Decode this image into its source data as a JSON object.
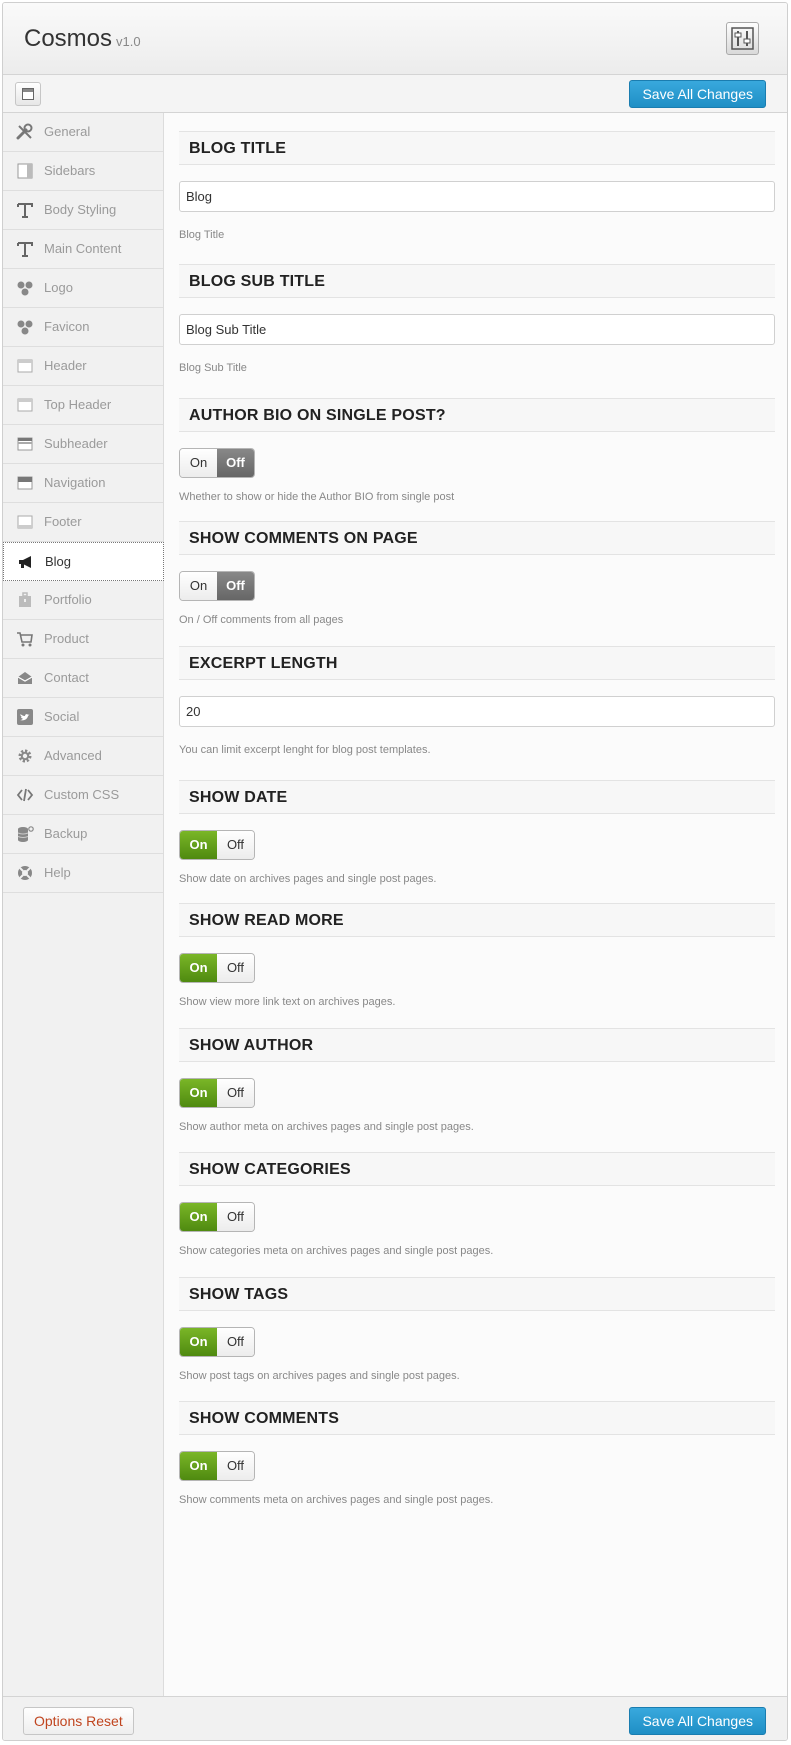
{
  "app": {
    "title": "Cosmos",
    "version": "v1.0"
  },
  "toolbar": {
    "save_label": "Save All Changes"
  },
  "footer": {
    "reset_label": "Options Reset",
    "save_label": "Save All Changes"
  },
  "sidebar": {
    "items": [
      {
        "label": "General",
        "icon": "wrench-icon"
      },
      {
        "label": "Sidebars",
        "icon": "sidebar-layout-icon"
      },
      {
        "label": "Body Styling",
        "icon": "typography-icon"
      },
      {
        "label": "Main Content",
        "icon": "typography-icon"
      },
      {
        "label": "Logo",
        "icon": "circles-icon"
      },
      {
        "label": "Favicon",
        "icon": "circles-icon"
      },
      {
        "label": "Header",
        "icon": "header-layout-icon"
      },
      {
        "label": "Top Header",
        "icon": "header-layout-icon"
      },
      {
        "label": "Subheader",
        "icon": "subheader-layout-icon"
      },
      {
        "label": "Navigation",
        "icon": "navigation-layout-icon"
      },
      {
        "label": "Footer",
        "icon": "footer-layout-icon"
      },
      {
        "label": "Blog",
        "icon": "megaphone-icon",
        "active": true
      },
      {
        "label": "Portfolio",
        "icon": "briefcase-icon"
      },
      {
        "label": "Product",
        "icon": "cart-icon"
      },
      {
        "label": "Contact",
        "icon": "envelope-icon"
      },
      {
        "label": "Social",
        "icon": "twitter-bird-icon"
      },
      {
        "label": "Advanced",
        "icon": "gear-icon"
      },
      {
        "label": "Custom CSS",
        "icon": "code-icon"
      },
      {
        "label": "Backup",
        "icon": "database-icon"
      },
      {
        "label": "Help",
        "icon": "lifebuoy-icon"
      }
    ]
  },
  "toggle_labels": {
    "on": "On",
    "off": "Off"
  },
  "sections": [
    {
      "id": "blog-title",
      "title": "BLOG TITLE",
      "type": "text",
      "value": "Blog",
      "desc": "Blog Title"
    },
    {
      "id": "blog-sub-title",
      "title": "BLOG SUB TITLE",
      "type": "text",
      "value": "Blog Sub Title",
      "desc": "Blog Sub Title"
    },
    {
      "id": "author-bio",
      "title": "AUTHOR BIO ON SINGLE POST?",
      "type": "toggle",
      "state": "off",
      "desc": "Whether to show or hide the Author BIO from single post"
    },
    {
      "id": "show-comments-on-page",
      "title": "SHOW COMMENTS ON PAGE",
      "type": "toggle",
      "state": "off",
      "desc": "On / Off comments from all pages"
    },
    {
      "id": "excerpt-length",
      "title": "EXCERPT LENGTH",
      "type": "text",
      "value": "20",
      "desc": "You can limit excerpt lenght for blog post templates."
    },
    {
      "id": "show-date",
      "title": "SHOW DATE",
      "type": "toggle",
      "state": "on",
      "desc": "Show date on archives pages and single post pages."
    },
    {
      "id": "show-read-more",
      "title": "SHOW READ MORE",
      "type": "toggle",
      "state": "on",
      "desc": "Show view more link text on archives pages."
    },
    {
      "id": "show-author",
      "title": "SHOW AUTHOR",
      "type": "toggle",
      "state": "on",
      "desc": "Show author meta on archives pages and single post pages."
    },
    {
      "id": "show-categories",
      "title": "SHOW CATEGORIES",
      "type": "toggle",
      "state": "on",
      "desc": "Show categories meta on archives pages and single post pages."
    },
    {
      "id": "show-tags",
      "title": "SHOW TAGS",
      "type": "toggle",
      "state": "on",
      "desc": "Show post tags on archives pages and single post pages."
    },
    {
      "id": "show-comments",
      "title": "SHOW COMMENTS",
      "type": "toggle",
      "state": "on",
      "desc": "Show comments meta on archives pages and single post pages."
    }
  ]
}
